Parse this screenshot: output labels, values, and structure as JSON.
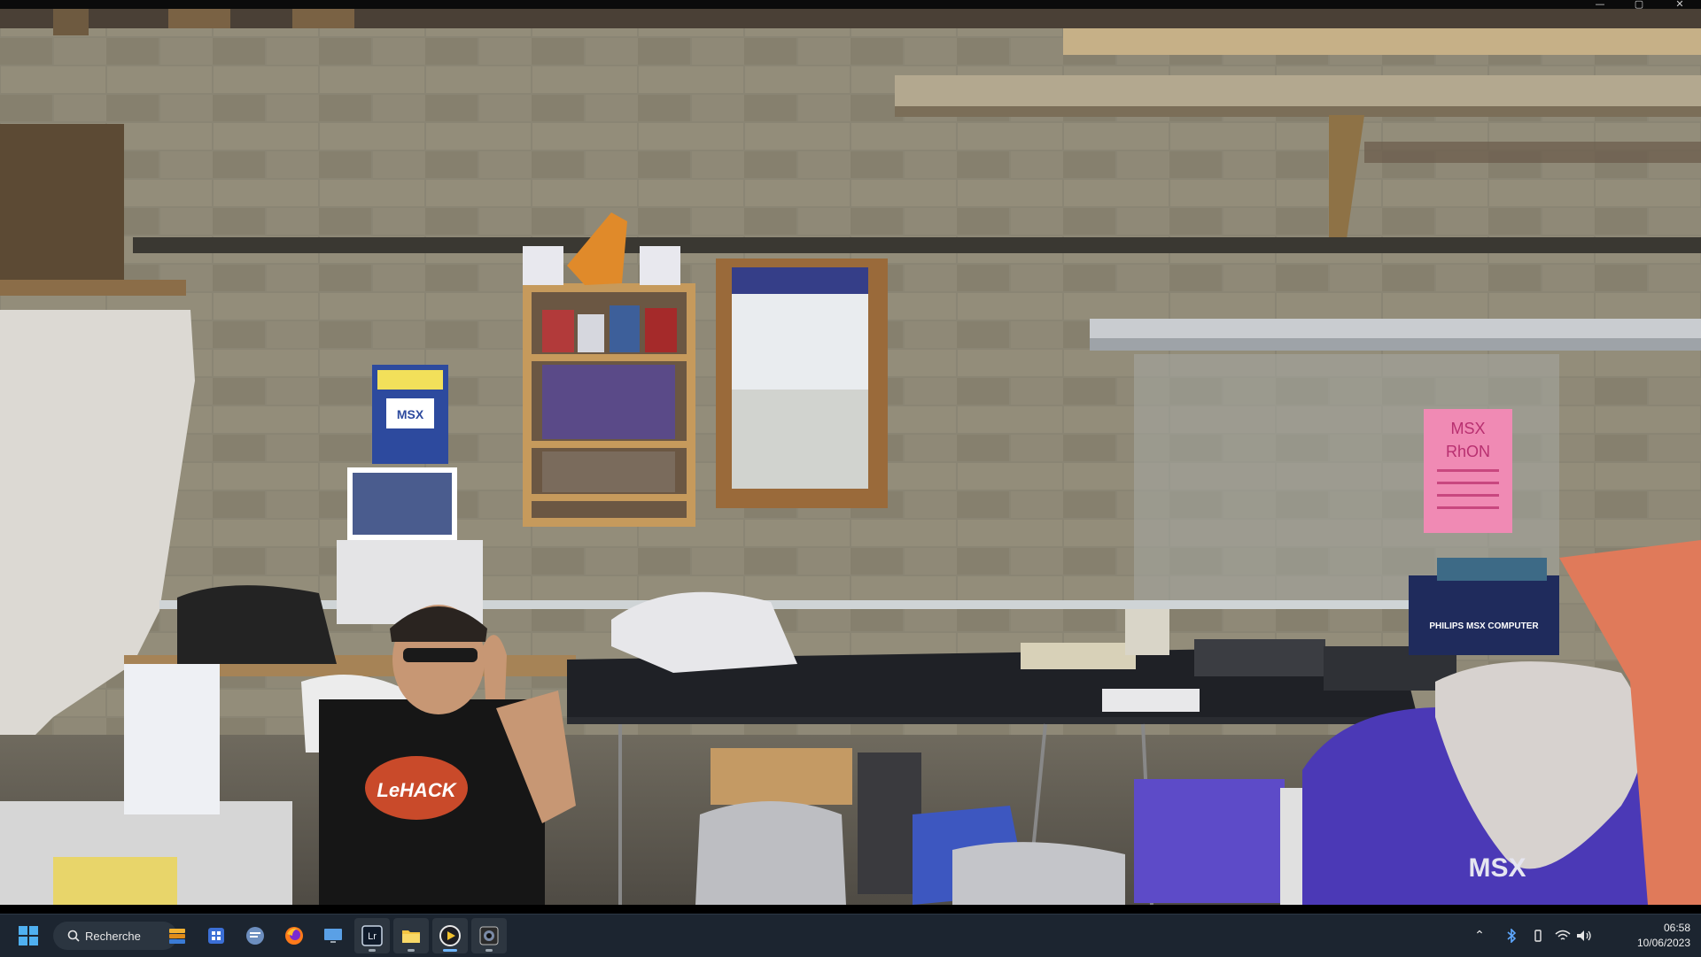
{
  "window": {
    "minimize_glyph": "—",
    "maximize_glyph": "▢",
    "close_glyph": "✕"
  },
  "scene": {
    "poster_text": "MSX",
    "box_text": "PHILIPS MSX COMPUTER",
    "tshirt_text": "LeHACK",
    "sign_line_1": "MSX",
    "sign_line_2": "RhON",
    "right_shirt_text": "MSX"
  },
  "taskbar": {
    "search_label": "Recherche",
    "pinned": [
      {
        "name": "start-button",
        "icon": "windows-icon"
      },
      {
        "name": "taskbar-app-1",
        "icon": "app-stack-icon"
      },
      {
        "name": "taskbar-app-2",
        "icon": "store-icon"
      },
      {
        "name": "taskbar-app-3",
        "icon": "chat-icon"
      },
      {
        "name": "taskbar-firefox",
        "icon": "firefox-icon"
      },
      {
        "name": "taskbar-desktop",
        "icon": "monitor-icon"
      },
      {
        "name": "taskbar-lightroom",
        "icon": "lightroom-icon",
        "label": "Lr"
      },
      {
        "name": "taskbar-file-explorer",
        "icon": "folder-icon"
      },
      {
        "name": "taskbar-media-player",
        "icon": "play-icon"
      },
      {
        "name": "taskbar-camera-app",
        "icon": "camera-icon"
      }
    ],
    "clock_time": "06:58",
    "clock_date": "10/06/2023"
  }
}
